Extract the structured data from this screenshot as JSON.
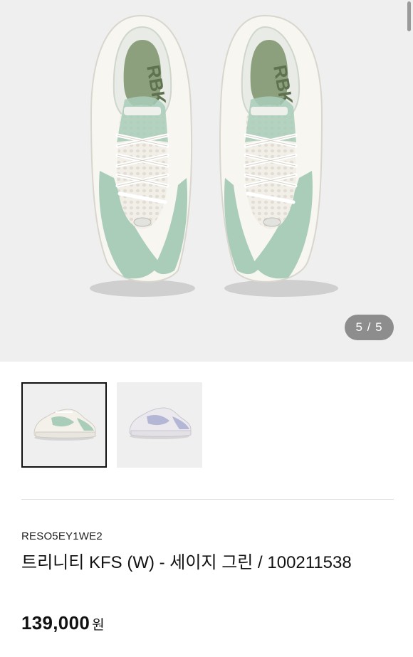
{
  "gallery": {
    "counter": "5 / 5",
    "thumbnails": [
      {
        "name": "sage-green",
        "selected": true,
        "colors": [
          "#a9cdb9",
          "#f3f1ea"
        ]
      },
      {
        "name": "lavender",
        "selected": false,
        "colors": [
          "#b4b6d6",
          "#ece9ee"
        ]
      }
    ]
  },
  "product": {
    "sku": "RESO5EY1WE2",
    "title": "트리니티 KFS (W) - 세이지 그린 / 100211538",
    "price": "139,000",
    "currency": "원"
  },
  "colors": {
    "accent_green": "#a9cdb9",
    "insole_green": "#7a8f6a",
    "counter_bg": "#8d8d8d"
  }
}
